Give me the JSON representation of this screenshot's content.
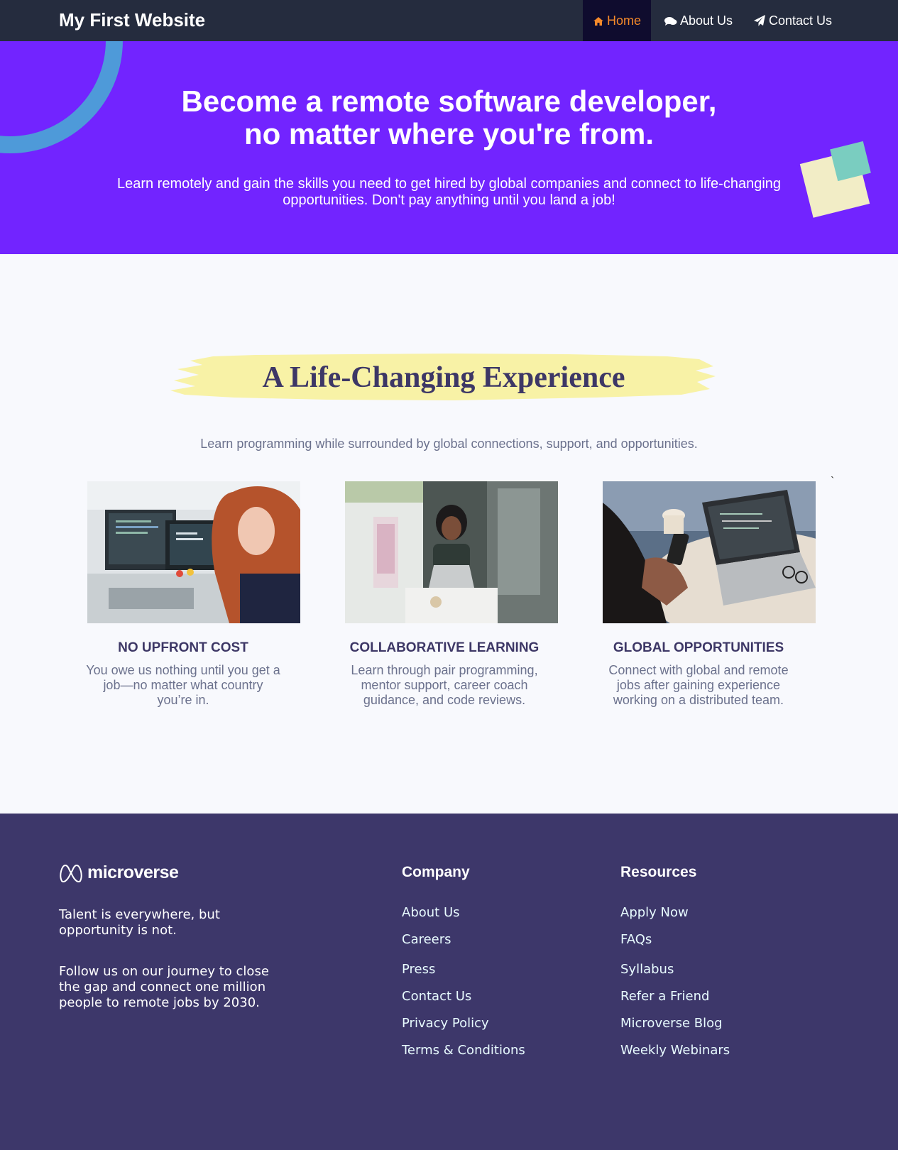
{
  "nav": {
    "brand": "My First Website",
    "items": [
      {
        "label": "Home",
        "icon": "home-icon",
        "active": true
      },
      {
        "label": "About Us",
        "icon": "comments-icon",
        "active": false
      },
      {
        "label": "Contact Us",
        "icon": "paper-plane-icon",
        "active": false
      }
    ]
  },
  "hero": {
    "title_line1": "Become a remote software developer,",
    "title_line2": "no matter where you're from.",
    "subtitle": "Learn remotely and gain the skills you need to get hired by global companies and connect to life-changing opportunities. Don't pay anything until you land a job!"
  },
  "section": {
    "heading": "A Life-Changing Experience",
    "subheading": "Learn programming while surrounded by global connections, support, and opportunities.",
    "stray_char": "`",
    "cards": [
      {
        "title": "NO UPFRONT COST",
        "text": "You owe us nothing until you get a job—no matter what country you’re in.",
        "image": "woman-at-desktop-monitors-photo"
      },
      {
        "title": "COLLABORATIVE LEARNING",
        "text": "Learn through pair programming, mentor support, career coach guidance, and code reviews.",
        "image": "woman-with-laptop-outdoor-cafe-photo"
      },
      {
        "title": "GLOBAL OPPORTUNITIES",
        "text": "Connect with global and remote jobs after gaining experience working on a distributed team.",
        "image": "hands-phone-laptop-photo"
      }
    ]
  },
  "footer": {
    "logo_text": "microverse",
    "tagline": "Talent is everywhere, but opportunity is not.",
    "mission": "Follow us on our journey to close the gap and connect one million people to remote jobs by 2030.",
    "company": {
      "title": "Company",
      "links": [
        "About Us",
        "Careers",
        "Press",
        "Contact Us",
        "Privacy Policy",
        "Terms & Conditions"
      ]
    },
    "resources": {
      "title": "Resources",
      "links": [
        "Apply Now",
        "FAQs",
        "Syllabus",
        "Refer a Friend",
        "Microverse Blog",
        "Weekly Webinars"
      ]
    }
  },
  "colors": {
    "nav_bg": "#252c3e",
    "nav_active_bg": "#0f0c2e",
    "nav_active_text": "#f68a2a",
    "hero_bg": "#7224ff",
    "highlight": "#f8f2a6",
    "heading": "#3d3766",
    "footer_bg": "#3d376a"
  }
}
